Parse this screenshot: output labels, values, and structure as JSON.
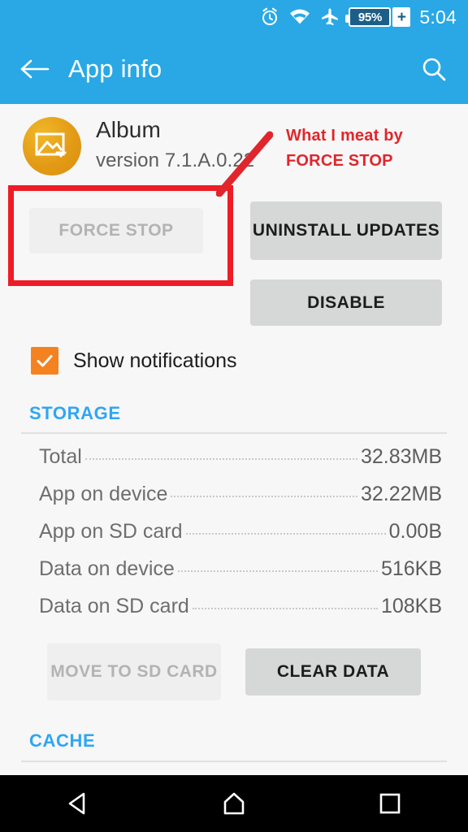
{
  "status_bar": {
    "icons": [
      "alarm-icon",
      "wifi-icon",
      "airplane-mode-icon"
    ],
    "battery_percent": "95%",
    "charging_symbol": "+",
    "time": "5:04"
  },
  "app_bar": {
    "back_icon": "back-arrow-icon",
    "title": "App info",
    "search_icon": "search-icon"
  },
  "app": {
    "icon": "album-app-icon",
    "name": "Album",
    "version": "version 7.1.A.0.22"
  },
  "actions": {
    "force_stop": "FORCE STOP",
    "uninstall_updates": "UNINSTALL UPDATES",
    "disable": "DISABLE"
  },
  "annotation": {
    "line1": "What I meat by",
    "line2": "FORCE STOP",
    "color": "#e0262c"
  },
  "notifications": {
    "label": "Show notifications",
    "checked": true,
    "check_color": "#f58220"
  },
  "storage": {
    "header": "STORAGE",
    "rows": [
      {
        "label": "Total",
        "value": "32.83MB"
      },
      {
        "label": "App on device",
        "value": "32.22MB"
      },
      {
        "label": "App on SD card",
        "value": "0.00B"
      },
      {
        "label": "Data on device",
        "value": "516KB"
      },
      {
        "label": "Data on SD card",
        "value": "108KB"
      }
    ],
    "move_to_sd": "MOVE TO SD CARD",
    "clear_data": "CLEAR DATA"
  },
  "cache": {
    "header": "CACHE"
  },
  "nav_bar": {
    "back": "nav-back-icon",
    "home": "nav-home-icon",
    "recents": "nav-recents-icon"
  },
  "theme": {
    "accent_blue": "#29a8e5",
    "section_blue": "#2fa6f2",
    "page_bg": "#f7f7f7",
    "button_gray": "#d6d7d7"
  }
}
